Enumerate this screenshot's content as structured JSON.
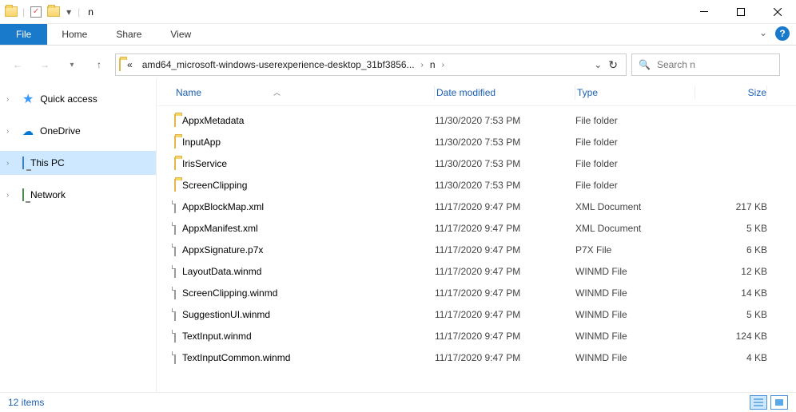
{
  "window": {
    "title": "n"
  },
  "ribbon": {
    "file": "File",
    "tabs": [
      "Home",
      "Share",
      "View"
    ]
  },
  "nav": {
    "breadcrumb_trunc": "«",
    "crumb1": "amd64_microsoft-windows-userexperience-desktop_31bf3856...",
    "crumb2": "n"
  },
  "search": {
    "placeholder": "Search n"
  },
  "navpane": {
    "items": [
      {
        "label": "Quick access"
      },
      {
        "label": "OneDrive"
      },
      {
        "label": "This PC"
      },
      {
        "label": "Network"
      }
    ]
  },
  "columns": {
    "name": "Name",
    "date": "Date modified",
    "type": "Type",
    "size": "Size"
  },
  "files": [
    {
      "icon": "folder",
      "name": "AppxMetadata",
      "date": "11/30/2020 7:53 PM",
      "type": "File folder",
      "size": ""
    },
    {
      "icon": "folder",
      "name": "InputApp",
      "date": "11/30/2020 7:53 PM",
      "type": "File folder",
      "size": ""
    },
    {
      "icon": "folder",
      "name": "IrisService",
      "date": "11/30/2020 7:53 PM",
      "type": "File folder",
      "size": ""
    },
    {
      "icon": "folder",
      "name": "ScreenClipping",
      "date": "11/30/2020 7:53 PM",
      "type": "File folder",
      "size": ""
    },
    {
      "icon": "file",
      "name": "AppxBlockMap.xml",
      "date": "11/17/2020 9:47 PM",
      "type": "XML Document",
      "size": "217 KB"
    },
    {
      "icon": "file",
      "name": "AppxManifest.xml",
      "date": "11/17/2020 9:47 PM",
      "type": "XML Document",
      "size": "5 KB"
    },
    {
      "icon": "file",
      "name": "AppxSignature.p7x",
      "date": "11/17/2020 9:47 PM",
      "type": "P7X File",
      "size": "6 KB"
    },
    {
      "icon": "file",
      "name": "LayoutData.winmd",
      "date": "11/17/2020 9:47 PM",
      "type": "WINMD File",
      "size": "12 KB"
    },
    {
      "icon": "file",
      "name": "ScreenClipping.winmd",
      "date": "11/17/2020 9:47 PM",
      "type": "WINMD File",
      "size": "14 KB"
    },
    {
      "icon": "file",
      "name": "SuggestionUI.winmd",
      "date": "11/17/2020 9:47 PM",
      "type": "WINMD File",
      "size": "5 KB"
    },
    {
      "icon": "file",
      "name": "TextInput.winmd",
      "date": "11/17/2020 9:47 PM",
      "type": "WINMD File",
      "size": "124 KB"
    },
    {
      "icon": "file",
      "name": "TextInputCommon.winmd",
      "date": "11/17/2020 9:47 PM",
      "type": "WINMD File",
      "size": "4 KB"
    }
  ],
  "status": {
    "count": "12 items"
  }
}
